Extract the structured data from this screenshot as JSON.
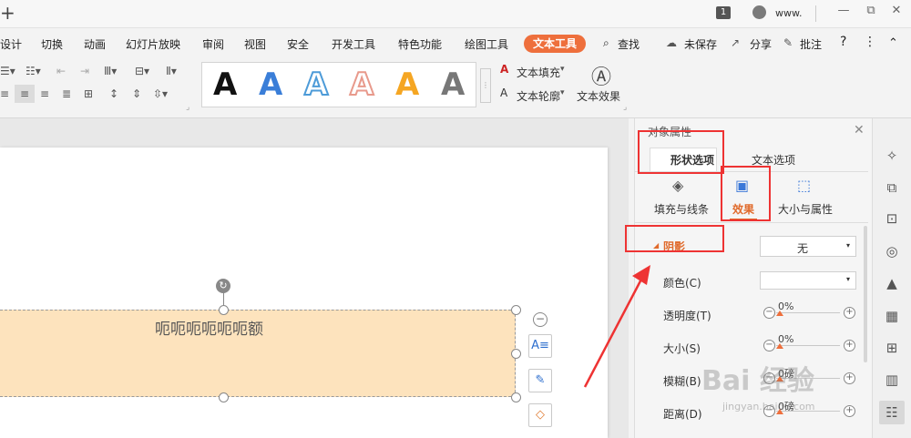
{
  "titlebar": {
    "plus": "+",
    "page_count": "1",
    "user": "www.",
    "minimize": "—",
    "restore": "⧉",
    "close": "✕"
  },
  "menu": [
    "设计",
    "切换",
    "动画",
    "幻灯片放映",
    "审阅",
    "视图",
    "安全",
    "开发工具",
    "特色功能",
    "绘图工具",
    "文本工具",
    "查找"
  ],
  "menu_right": {
    "save": "未保存",
    "share": "分享",
    "comment": "批注",
    "help": "?",
    "more": "⋮",
    "collapse": "⌃"
  },
  "ribbon": {
    "art_samples": [
      "A",
      "A",
      "A",
      "A",
      "A",
      "A"
    ],
    "text_fill": "文本填充",
    "text_outline": "文本轮廓",
    "text_effects": "文本效果"
  },
  "document": {
    "textbox_text": "呃呃呃呃呃呃额"
  },
  "panel": {
    "title": "对象属性",
    "tab_shape": "形状选项",
    "tab_text": "文本选项",
    "sub_fill": "填充与线条",
    "sub_effect": "效果",
    "sub_size": "大小与属性",
    "section_shadow": "阴影",
    "shadow_value": "无",
    "rows": [
      {
        "label": "颜色(C)",
        "value": ""
      },
      {
        "label": "透明度(T)",
        "value": "0%"
      },
      {
        "label": "大小(S)",
        "value": "0%"
      },
      {
        "label": "模糊(B)",
        "value": "0磅"
      },
      {
        "label": "距离(D)",
        "value": "0磅"
      }
    ]
  },
  "watermark": {
    "main": "Bai 经验",
    "sub": "jingyan.baidu.com"
  },
  "colors": {
    "accent": "#ee6f3c",
    "highlight": "#e33333",
    "shape_fill": "#fde3bd"
  }
}
